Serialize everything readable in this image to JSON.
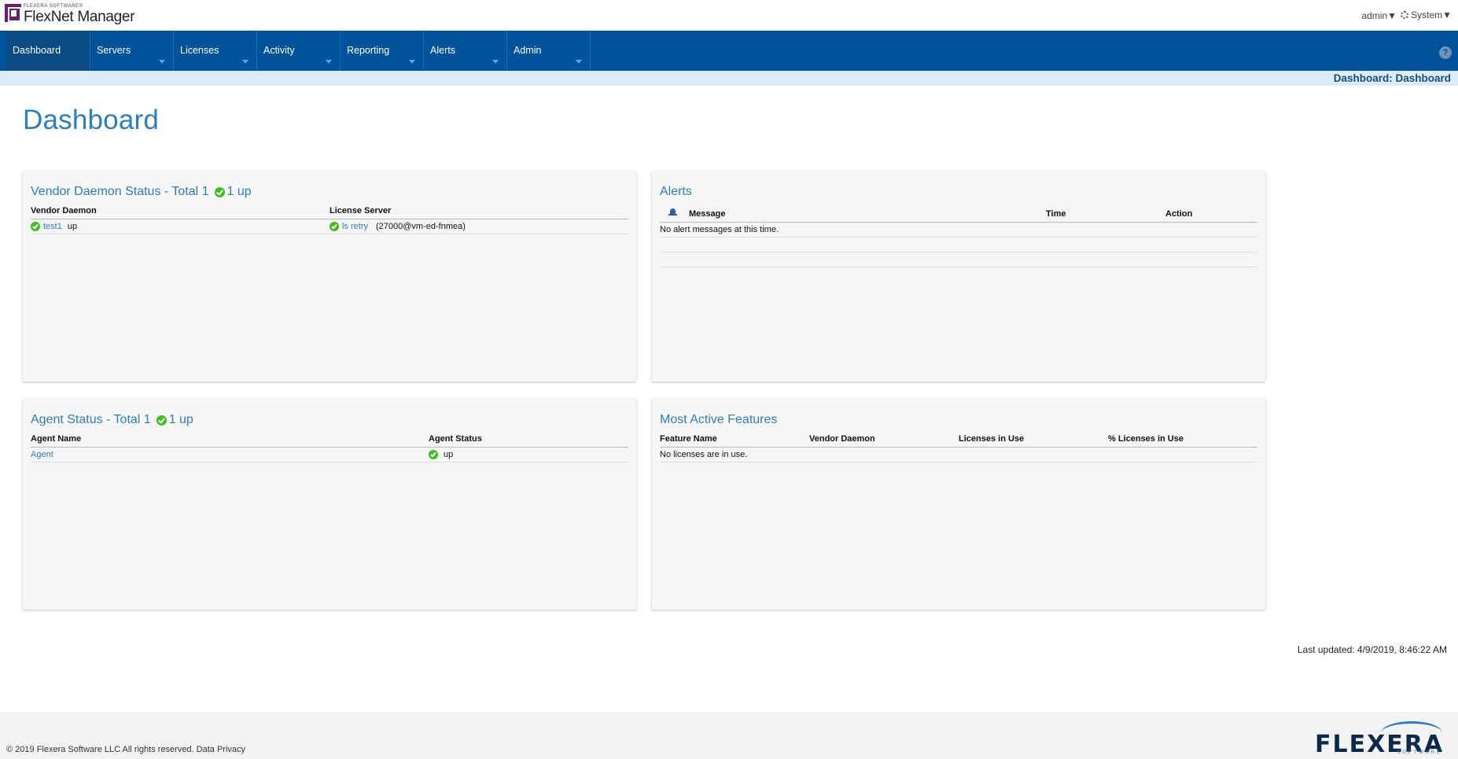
{
  "header": {
    "logo_small": "FLEXERA SOFTWARE®",
    "logo_name": "FlexNet Manager",
    "user_menu": "admin▼",
    "system_menu": "System▼"
  },
  "nav": {
    "items": [
      {
        "label": "Dashboard",
        "active": true
      },
      {
        "label": "Servers"
      },
      {
        "label": "Licenses"
      },
      {
        "label": "Activity"
      },
      {
        "label": "Reporting"
      },
      {
        "label": "Alerts"
      },
      {
        "label": "Admin"
      }
    ],
    "help": "?"
  },
  "breadcrumb": "Dashboard:  Dashboard",
  "page_title": "Dashboard",
  "vendor_panel": {
    "title": "Vendor Daemon Status - Total 1",
    "status": "1 up",
    "columns": [
      "Vendor Daemon",
      "License Server"
    ],
    "rows": [
      {
        "daemon": "test1",
        "daemon_status": "up",
        "server_link": "ls retry",
        "server_detail": "(27000@vm-ed-fnmea)"
      }
    ]
  },
  "alerts_panel": {
    "title": "Alerts",
    "columns": [
      "Message",
      "Time",
      "Action"
    ],
    "empty_message": "No alert messages at this time."
  },
  "agent_panel": {
    "title": "Agent Status - Total 1",
    "status": "1 up",
    "columns": [
      "Agent Name",
      "Agent Status"
    ],
    "rows": [
      {
        "name": "Agent",
        "status": "up"
      }
    ]
  },
  "features_panel": {
    "title": "Most Active Features",
    "columns": [
      "Feature Name",
      "Vendor Daemon",
      "Licenses in Use",
      "% Licenses in Use"
    ],
    "empty_message": "No licenses are in use."
  },
  "last_updated": "Last updated: 4/9/2019, 8:46:22 AM",
  "footer": {
    "copyright": "© 2019 Flexera Software LLC All rights reserved. Data Privacy",
    "brand": "FLEXERA",
    "brand_sub": "SOFTWARE"
  },
  "colors": {
    "nav_bg": "#00539b",
    "accent": "#2c7fb9",
    "ok_green": "#3fbf1f"
  }
}
